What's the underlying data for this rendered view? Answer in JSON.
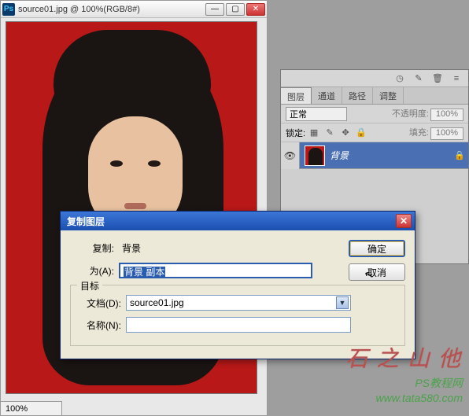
{
  "doc": {
    "ps_badge": "Ps",
    "title": "source01.jpg @ 100%(RGB/8#)",
    "zoom": "100%"
  },
  "panel": {
    "tabs": [
      "图层",
      "通道",
      "路径",
      "调整"
    ],
    "blend_mode": "正常",
    "opacity_label": "不透明度:",
    "opacity_value": "100%",
    "lock_label": "锁定:",
    "fill_label": "填充:",
    "fill_value": "100%",
    "layer": {
      "name": "背景"
    }
  },
  "dialog": {
    "title": "复制图层",
    "copy_label": "复制:",
    "copy_value": "背景",
    "as_label": "为(A):",
    "as_value": "背景 副本",
    "target_legend": "目标",
    "doc_label": "文档(D):",
    "doc_value": "source01.jpg",
    "name_label": "名称(N):",
    "name_value": "",
    "ok": "确定",
    "cancel": "取消"
  },
  "watermark": {
    "site_cn": "PS教程网",
    "site_url": "www.tata580.com",
    "brush": "他山之石"
  }
}
